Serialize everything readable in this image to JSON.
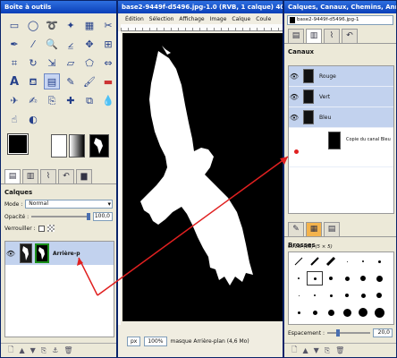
{
  "toolbox": {
    "title": "Boîte à outils",
    "tools": [
      "rect-select-icon",
      "ellipse-select-icon",
      "lasso-icon",
      "fuzzy-select-icon",
      "color-select-icon",
      "scissors-icon",
      "paths-icon",
      "color-picker-icon",
      "zoom-icon",
      "measure-icon",
      "move-icon",
      "align-icon",
      "crop-icon",
      "rotate-icon",
      "scale-icon",
      "shear-icon",
      "perspective-icon",
      "flip-icon",
      "text-icon",
      "bucket-fill-icon",
      "blend-icon",
      "pencil-icon",
      "paintbrush-icon",
      "eraser-icon",
      "airbrush-icon",
      "ink-icon",
      "clone-icon",
      "heal-icon",
      "perspective-clone-icon",
      "blur-icon",
      "smudge-icon",
      "dodge-burn-icon"
    ],
    "layers_panel": {
      "heading": "Calques",
      "mode_label": "Mode :",
      "mode_value": "Normal",
      "opacity_label": "Opacité :",
      "opacity_value": "100,0",
      "lock_label": "Verrouiller :",
      "layer_name": "Arrière-p"
    }
  },
  "image_window": {
    "title": "base2-9449f-d5496.jpg-1.0 (RVB, 1 calque) 407",
    "menu": [
      "Édition",
      "Sélection",
      "Affichage",
      "Image",
      "Calque",
      "Coule"
    ],
    "unit": "px",
    "zoom": "100%",
    "status": "masque Arrière-plan (4,6 Mo)"
  },
  "dock": {
    "title": "Calques, Canaux, Chemins, Ann",
    "image_selector": "base2-9449f-d5496.jpg-1",
    "channels_heading": "Canaux",
    "channels": [
      "Rouge",
      "Vert",
      "Bleu"
    ],
    "channel_mask_label": "Copie du canal Bleu",
    "brushes_heading": "Brosses",
    "brush_name": "Circle (03) (5 × 5)",
    "spacing_label": "Espacement :",
    "spacing_value": "20,0"
  },
  "colors": {
    "arrow": "#e02020",
    "mask_border": "#1a8f1a",
    "selection_bg": "#c2d2ee"
  }
}
